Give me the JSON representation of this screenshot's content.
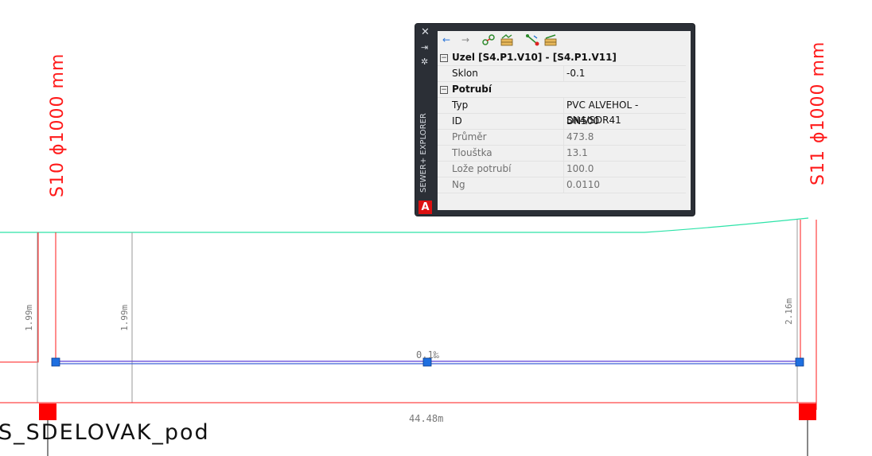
{
  "drawing": {
    "left_manhole_label": "S10  ϕ1000  mm",
    "right_manhole_label": "S11  ϕ1000  mm",
    "depth_left_1": "1.99m",
    "depth_left_2": "1.99m",
    "depth_right": "2.16m",
    "slope_label": "0.1‰",
    "length_label": "44.48m",
    "layer_text": "S_SDELOVAK_pod",
    "colors": {
      "manhole": "#ff1a1a",
      "terrain": "#2de3a8",
      "pipe": "#5a3fd6",
      "grip": "#1e6fe0"
    }
  },
  "palette": {
    "title": "SEWER+ EXPLORER",
    "logo": "A",
    "titlebar_buttons": [
      "close-icon",
      "pin-icon",
      "settings-icon"
    ],
    "toolbar": [
      "back-arrow-icon",
      "forward-arrow-icon",
      "node-profile-icon",
      "node-table-icon",
      "pipe-profile-icon",
      "pipe-table-icon"
    ],
    "rows": [
      {
        "type": "category",
        "label": "Uzel [S4.P1.V10] - [S4.P1.V11]"
      },
      {
        "type": "property",
        "key": "Sklon",
        "value": "-0.1",
        "readonly": false
      },
      {
        "type": "category",
        "label": "Potrubí"
      },
      {
        "type": "property",
        "key": "Typ",
        "value": "PVC ALVEHOL - SN4/SDR41",
        "readonly": false
      },
      {
        "type": "property",
        "key": "ID",
        "value": "DN500",
        "readonly": false
      },
      {
        "type": "property",
        "key": "Průměr",
        "value": "473.8",
        "readonly": true
      },
      {
        "type": "property",
        "key": "Tlouštka",
        "value": "13.1",
        "readonly": true
      },
      {
        "type": "property",
        "key": "Lože potrubí",
        "value": "100.0",
        "readonly": true
      },
      {
        "type": "property",
        "key": "Ng",
        "value": "0.0110",
        "readonly": true
      }
    ]
  }
}
